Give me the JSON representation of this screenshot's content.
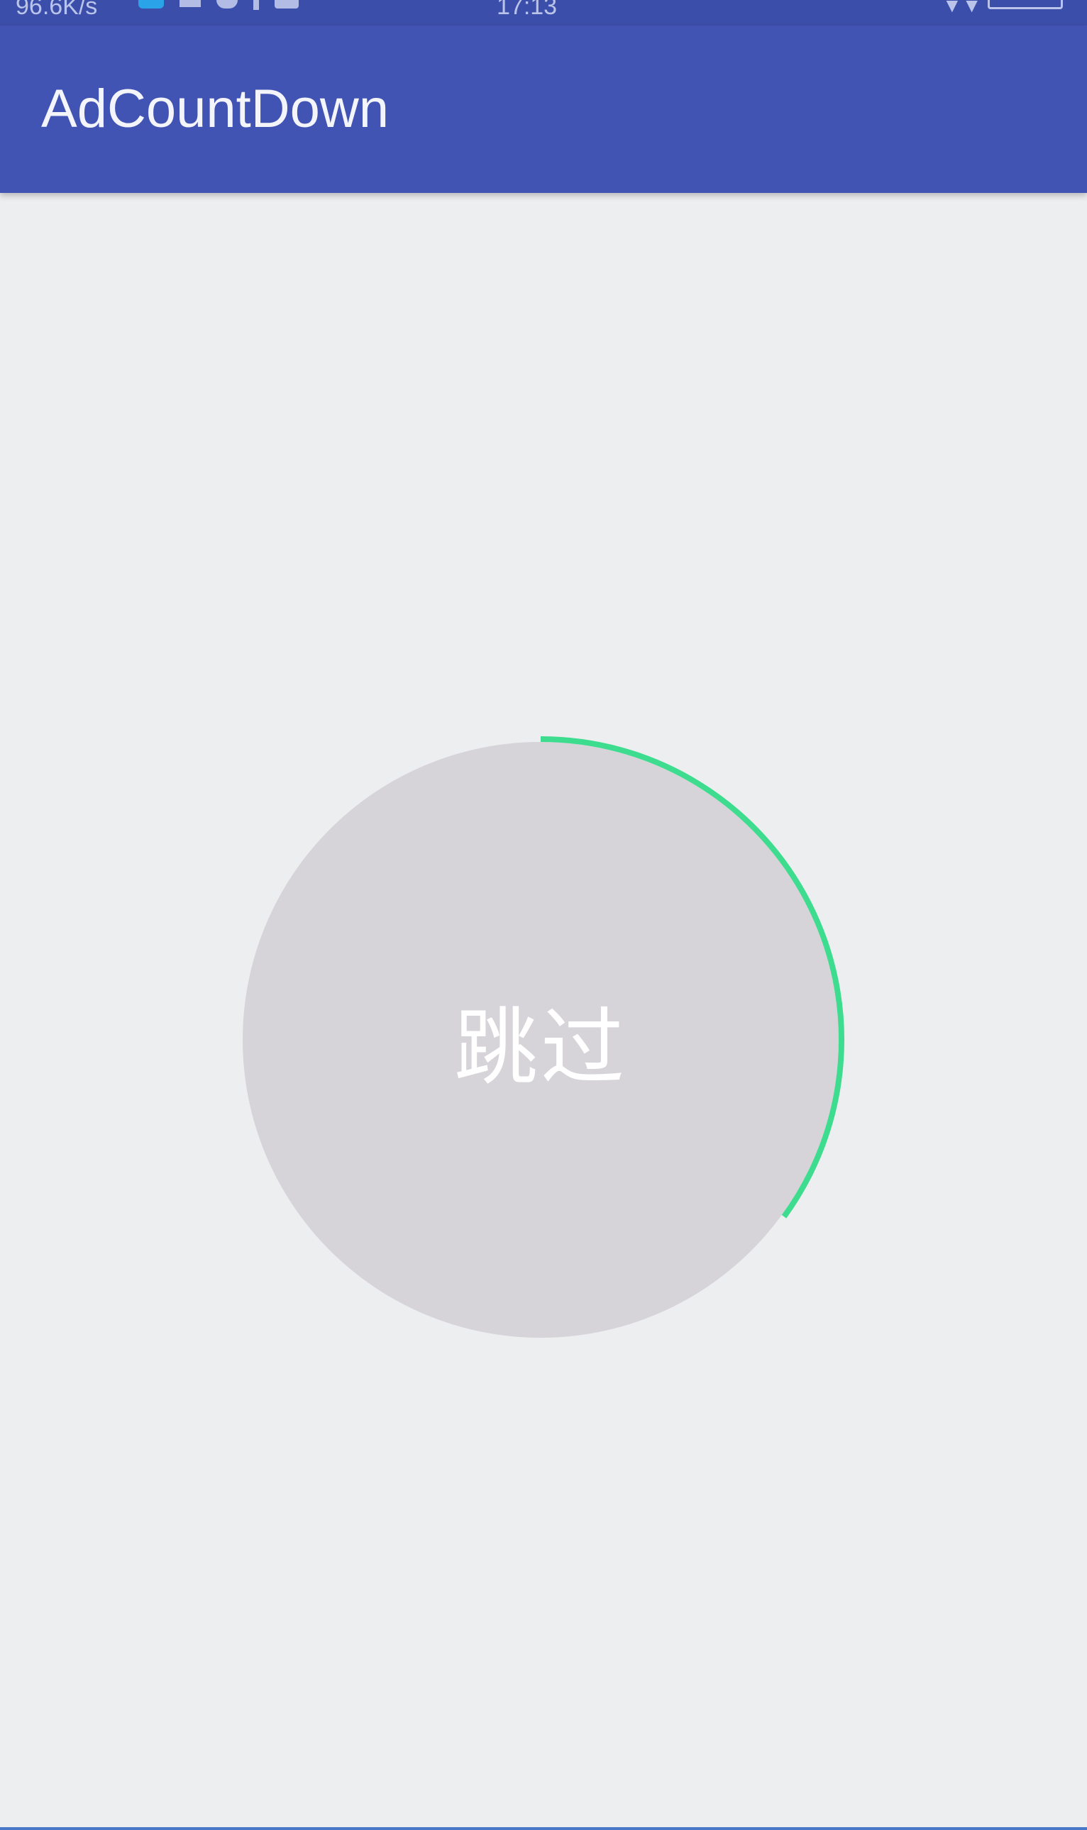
{
  "status_bar": {
    "left_text": "96.6K/s",
    "time": "17:13"
  },
  "app_bar": {
    "title": "AdCountDown"
  },
  "countdown": {
    "label": "跳过",
    "progress": 0.35,
    "circle_color": "#d6d4d8",
    "arc_color": "#3ddc8e",
    "label_color": "#ffffff"
  },
  "colors": {
    "primary": "#4254b3",
    "primary_dark": "#3b4ea9",
    "background": "#edeef0"
  }
}
